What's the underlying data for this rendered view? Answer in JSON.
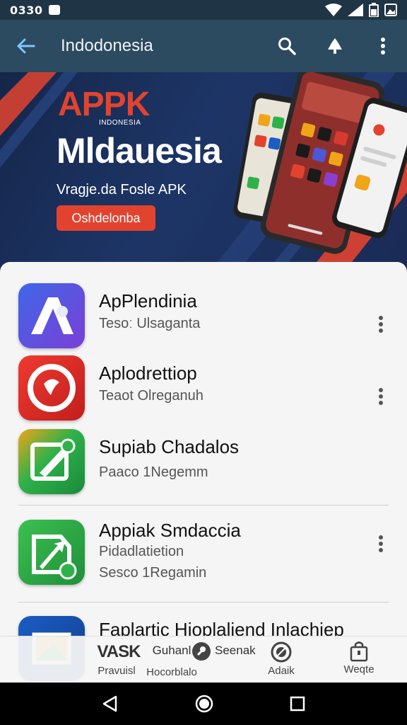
{
  "status_bar": {
    "time": "0330",
    "icons": [
      "notification-icon",
      "wifi-icon",
      "signal-icon",
      "battery-icon",
      "gallery-icon"
    ]
  },
  "app_bar": {
    "title": "Indodonesia",
    "icons": [
      "back-arrow-icon",
      "search-icon",
      "notification-bell-icon",
      "more-vert-icon"
    ]
  },
  "banner": {
    "logo_text": "APPK",
    "logo_subtext": "INDONESIA",
    "title": "Mldauesia",
    "description": "Vragje.da Fosle APK",
    "button_label": "Oshdelonba",
    "colors": {
      "accent": "#e2432f",
      "background": "#1d3566"
    }
  },
  "apps": [
    {
      "name": "ApPlendinia",
      "meta": "Tesoː  Ulsaganta",
      "icon": "letter-a-app-icon",
      "colors": [
        "#4c58d8",
        "#8b3fd0"
      ]
    },
    {
      "name": "Aplodrettiop",
      "meta": "Teaot  Olreganuh",
      "icon": "red-circle-app-icon",
      "colors": [
        "#e0302a",
        "#b51d1b"
      ]
    },
    {
      "name": "Supiab Chadalos",
      "meta": "Paaco  1Negemm",
      "icon": "green-pen-app-icon",
      "colors": [
        "#2eaa45",
        "#f0a418"
      ]
    },
    {
      "name": "Appiak Smdaccia",
      "meta": "Pidadlatietion",
      "meta2": "Sesco  1Regamin",
      "icon": "green-arrow-app-icon",
      "colors": [
        "#2fb14a",
        "#1e8d3a"
      ]
    },
    {
      "name": "Faplartic Hioplaliend Inlachiep",
      "icon": "blue-frame-app-icon",
      "colors": [
        "#1b5dc4",
        "#f0a418"
      ]
    }
  ],
  "bottom_nav": [
    {
      "label": "Pravuisl",
      "top_text": "VASK",
      "icon": "apk-icon"
    },
    {
      "label": "Hocorblalo",
      "top_text": "Guhanl",
      "icon": "category-icon"
    },
    {
      "label": "",
      "top_text": "Seenak",
      "icon": "search-circle-icon"
    },
    {
      "label": "Adaik",
      "top_text": "",
      "icon": "settings-icon"
    },
    {
      "label": "Weqte",
      "top_text": "",
      "icon": "bag-icon"
    }
  ],
  "system_nav": {
    "icons": [
      "back-triangle-icon",
      "home-circle-icon",
      "recents-square-icon"
    ]
  }
}
